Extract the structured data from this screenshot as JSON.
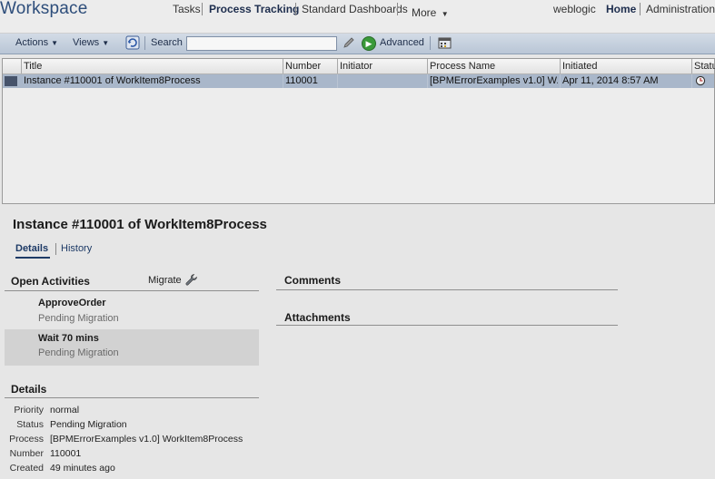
{
  "header": {
    "brand": "Workspace",
    "nav": [
      "Tasks",
      "Process Tracking",
      "Standard Dashboards",
      "More"
    ],
    "user": "weblogic",
    "right_links": [
      "Home",
      "Administration"
    ]
  },
  "toolbar": {
    "actions_label": "Actions",
    "views_label": "Views",
    "search_label": "Search",
    "search_value": "",
    "advanced_label": "Advanced"
  },
  "table": {
    "columns": [
      "Title",
      "Number",
      "Initiator",
      "Process Name",
      "Initiated",
      "Statu"
    ],
    "rows": [
      {
        "title": "Instance #110001 of WorkItem8Process",
        "number": "110001",
        "initiator": "",
        "process_name": "[BPMErrorExamples v1.0] W...",
        "initiated": "Apr 11, 2014 8:57 AM",
        "status_icon": "clock-icon"
      }
    ]
  },
  "detail": {
    "title": "Instance #110001 of WorkItem8Process",
    "tabs": [
      "Details",
      "History"
    ],
    "open_activities_label": "Open Activities",
    "migrate_label": "Migrate",
    "activities": [
      {
        "name": "ApproveOrder",
        "status": "Pending Migration"
      },
      {
        "name": "Wait 70 mins",
        "status": "Pending Migration"
      }
    ],
    "comments_label": "Comments",
    "attachments_label": "Attachments",
    "details_label": "Details",
    "fields": [
      {
        "label": "Priority",
        "value": "normal"
      },
      {
        "label": "Status",
        "value": "Pending Migration"
      },
      {
        "label": "Process",
        "value": "[BPMErrorExamples v1.0] WorkItem8Process"
      },
      {
        "label": "Number",
        "value": "110001"
      },
      {
        "label": "Created",
        "value": "49 minutes ago"
      }
    ]
  },
  "colors": {
    "accent": "#2d4d7a",
    "selected_row": "#a9b7ca",
    "toolbar": "#c3cedd"
  }
}
